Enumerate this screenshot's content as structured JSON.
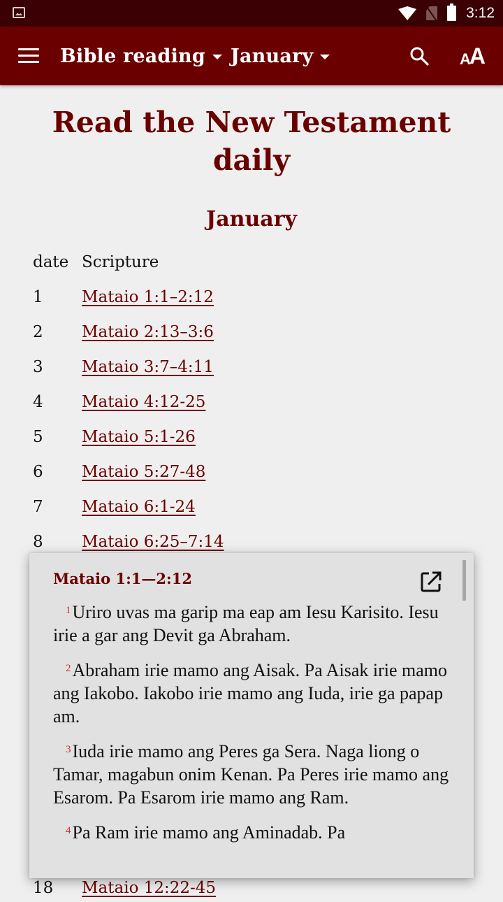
{
  "status_bar": {
    "time": "3:12",
    "icons": [
      "image-notification-icon",
      "wifi-icon",
      "no-sim-icon",
      "battery-icon"
    ]
  },
  "app_bar": {
    "menu_icon": "hamburger-menu-icon",
    "book_dropdown": "Bible reading",
    "month_dropdown": "January",
    "search_icon": "search-icon",
    "text_size_icon": "text-size-icon",
    "text_size_small": "A",
    "text_size_big": "A"
  },
  "page": {
    "title": "Read the New Testament daily",
    "month_heading": "January",
    "table": {
      "headers": {
        "date": "date",
        "scripture": "Scripture"
      },
      "rows": [
        {
          "date": "1",
          "scripture": "Mataio 1:1–2:12"
        },
        {
          "date": "2",
          "scripture": "Mataio 2:13–3:6"
        },
        {
          "date": "3",
          "scripture": "Mataio 3:7–4:11"
        },
        {
          "date": "4",
          "scripture": "Mataio 4:12-25"
        },
        {
          "date": "5",
          "scripture": "Mataio 5:1-26"
        },
        {
          "date": "6",
          "scripture": "Mataio 5:27-48"
        },
        {
          "date": "7",
          "scripture": "Mataio 6:1-24"
        },
        {
          "date": "8",
          "scripture": "Mataio 6:25–7:14"
        }
      ],
      "partial_row": {
        "date": "18",
        "scripture": "Mataio 12:22-45"
      }
    }
  },
  "popup": {
    "title": "Mataio 1:1—2:12",
    "open_icon": "open-in-new-icon",
    "verses": [
      {
        "num": "1",
        "text": "Uriro uvas ma garip ma eap am Iesu Karisito. Iesu irie a gar ang Devit ga Abraham."
      },
      {
        "num": "2",
        "text": "Abraham irie mamo ang Aisak. Pa Aisak irie mamo ang Iakobo. Iakobo irie mamo ang Iuda, irie ga papap am."
      },
      {
        "num": "3",
        "text": "Iuda irie mamo ang Peres ga Sera. Naga liong o Tamar, magabun onim Kenan. Pa Peres irie mamo ang Esarom. Pa Esarom irie mamo ang Ram."
      },
      {
        "num": "4",
        "text": "Pa Ram irie mamo ang Aminadab. Pa"
      }
    ]
  },
  "colors": {
    "status_bar": "#3a0003",
    "app_bar": "#6b0000",
    "accent_text": "#6b0000",
    "verse_number": "#c83232",
    "background": "#efefef",
    "popup_background": "#e1e1e1"
  }
}
